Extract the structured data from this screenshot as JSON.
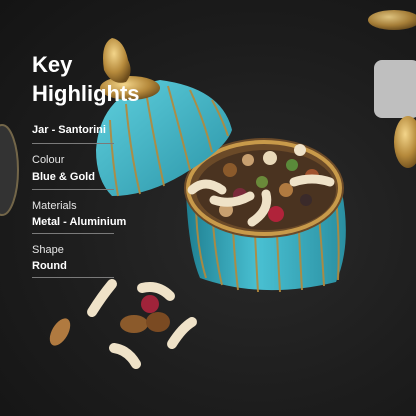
{
  "heading": "Key\nHighlights",
  "highlights": [
    {
      "label": "",
      "value": "Jar - Santorini"
    },
    {
      "label": "Colour",
      "value": "Blue & Gold"
    },
    {
      "label": "Materials",
      "value": "Metal - Aluminium"
    },
    {
      "label": "Shape",
      "value": "Round"
    }
  ],
  "colors": {
    "jar_blue": "#3fb3c6",
    "gold": "#b5893b",
    "background": "#1b1b1b",
    "text": "#ffffff"
  }
}
